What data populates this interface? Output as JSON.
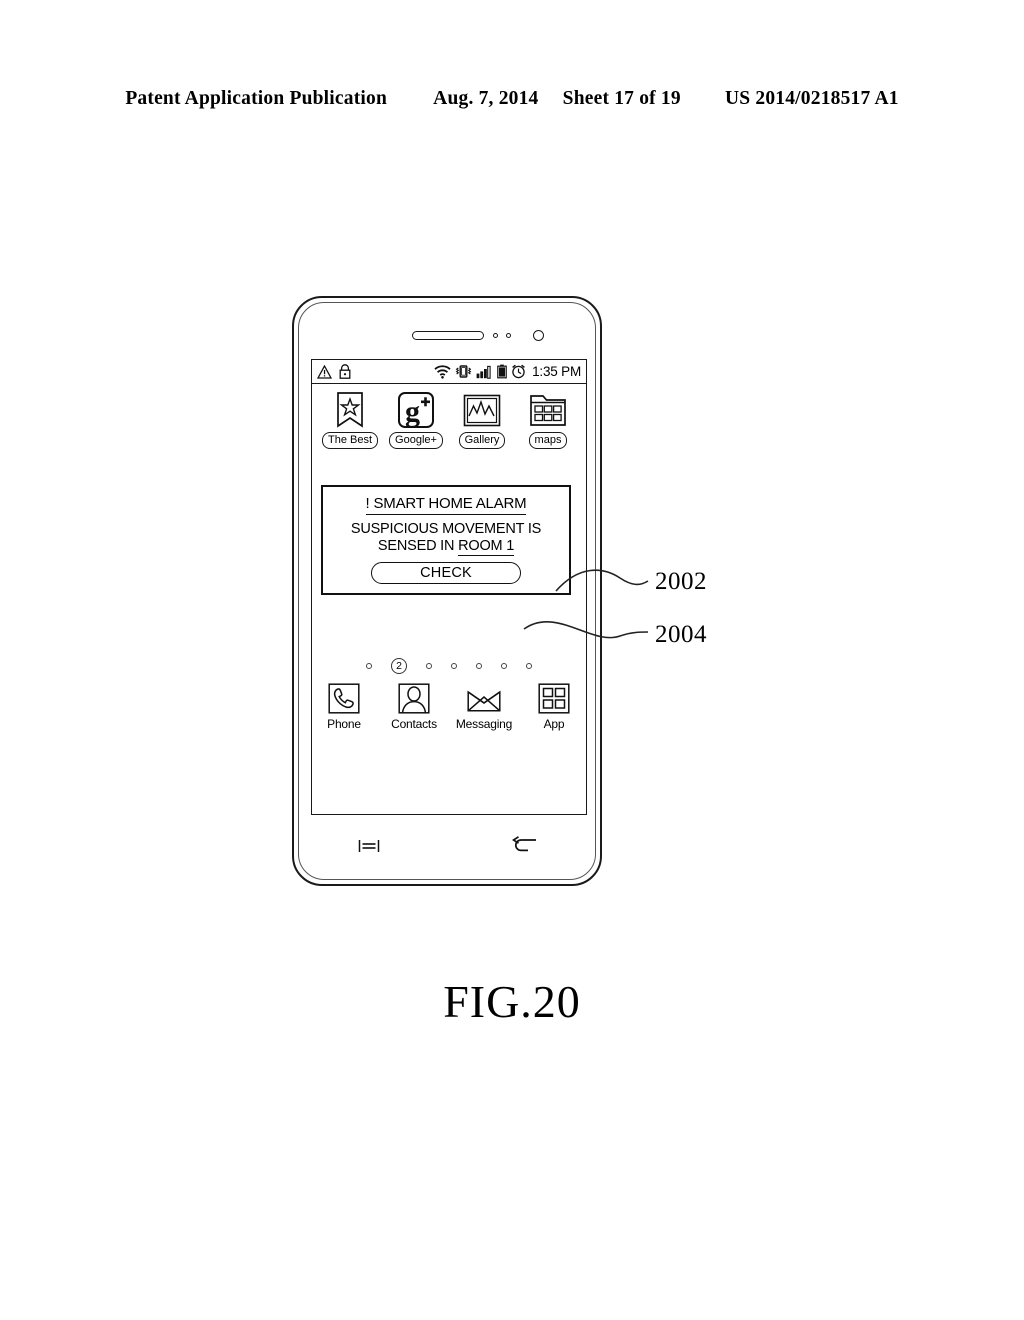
{
  "header": {
    "publication": "Patent Application Publication",
    "date": "Aug. 7, 2014",
    "sheet": "Sheet 17 of 19",
    "number": "US 2014/0218517 A1"
  },
  "figure": {
    "caption": "FIG.20"
  },
  "phone": {
    "status_bar": {
      "left_icons": [
        "warning-triangle-icon",
        "lock-icon"
      ],
      "right_icons": [
        "wifi-icon",
        "vibrate-icon",
        "signal-bars-icon",
        "battery-icon",
        "alarm-clock-icon"
      ],
      "time": "1:35 PM"
    },
    "apps": [
      {
        "label": "The Best",
        "icon": "bookmark-star-icon"
      },
      {
        "label": "Google+",
        "icon": "google-plus-icon"
      },
      {
        "label": "Gallery",
        "icon": "gallery-picture-icon"
      },
      {
        "label": "maps",
        "icon": "maps-folder-icon"
      }
    ],
    "alarm_dialog": {
      "title": "! SMART HOME ALARM",
      "message_line_1": "SUSPICIOUS MOVEMENT IS",
      "message_line_2_prefix": "SENSED IN ",
      "message_line_2_underlined": "ROOM 1",
      "check_button": "CHECK"
    },
    "page_indicator": {
      "total": 7,
      "current_index": 2,
      "current_label": "2"
    },
    "dock": [
      {
        "label": "Phone",
        "icon": "phone-handset-icon"
      },
      {
        "label": "Contacts",
        "icon": "contact-person-icon"
      },
      {
        "label": "Messaging",
        "icon": "envelope-icon"
      },
      {
        "label": "App",
        "icon": "app-grid-icon"
      }
    ],
    "nav_keys": [
      {
        "name": "menu-key",
        "icon": "menu-lines-icon"
      },
      {
        "name": "back-key",
        "icon": "back-arrow-icon"
      }
    ]
  },
  "callouts": [
    {
      "number": "2002",
      "target": "alarm-dialog"
    },
    {
      "number": "2004",
      "target": "check-button"
    }
  ]
}
